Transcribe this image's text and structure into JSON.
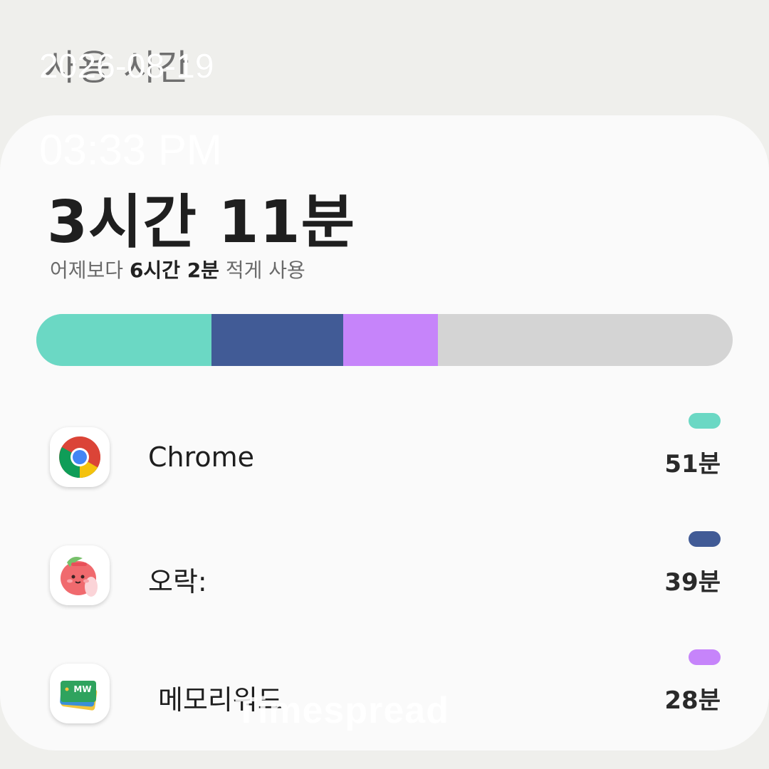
{
  "header": {
    "title": "사용 시간"
  },
  "overlay": {
    "date": "2026-08-19",
    "time": "03:33 PM",
    "watermark": "Timespread"
  },
  "summary": {
    "total": "3시간 11분",
    "compare_prefix": "어제보다",
    "compare_value": "6시간 2분",
    "compare_suffix": "적게 사용"
  },
  "usage_bar": {
    "segments": [
      {
        "app": "Chrome",
        "fraction": 0.252,
        "color": "#6bd8c4"
      },
      {
        "app": "오락:",
        "fraction": 0.189,
        "color": "#415b96"
      },
      {
        "app": "메모리워드",
        "fraction": 0.136,
        "color": "#c684fa"
      }
    ],
    "track_color": "#d4d4d4"
  },
  "apps": [
    {
      "name": "Chrome",
      "time": "51분",
      "color": "#6bd8c4",
      "icon": "chrome-icon"
    },
    {
      "name": "오락:",
      "time": "39분",
      "color": "#415b96",
      "icon": "peach-mascot-icon"
    },
    {
      "name": "메모리워드",
      "time": "28분",
      "color": "#c684fa",
      "icon": "memoryword-icon",
      "icon_text": "MW"
    }
  ]
}
